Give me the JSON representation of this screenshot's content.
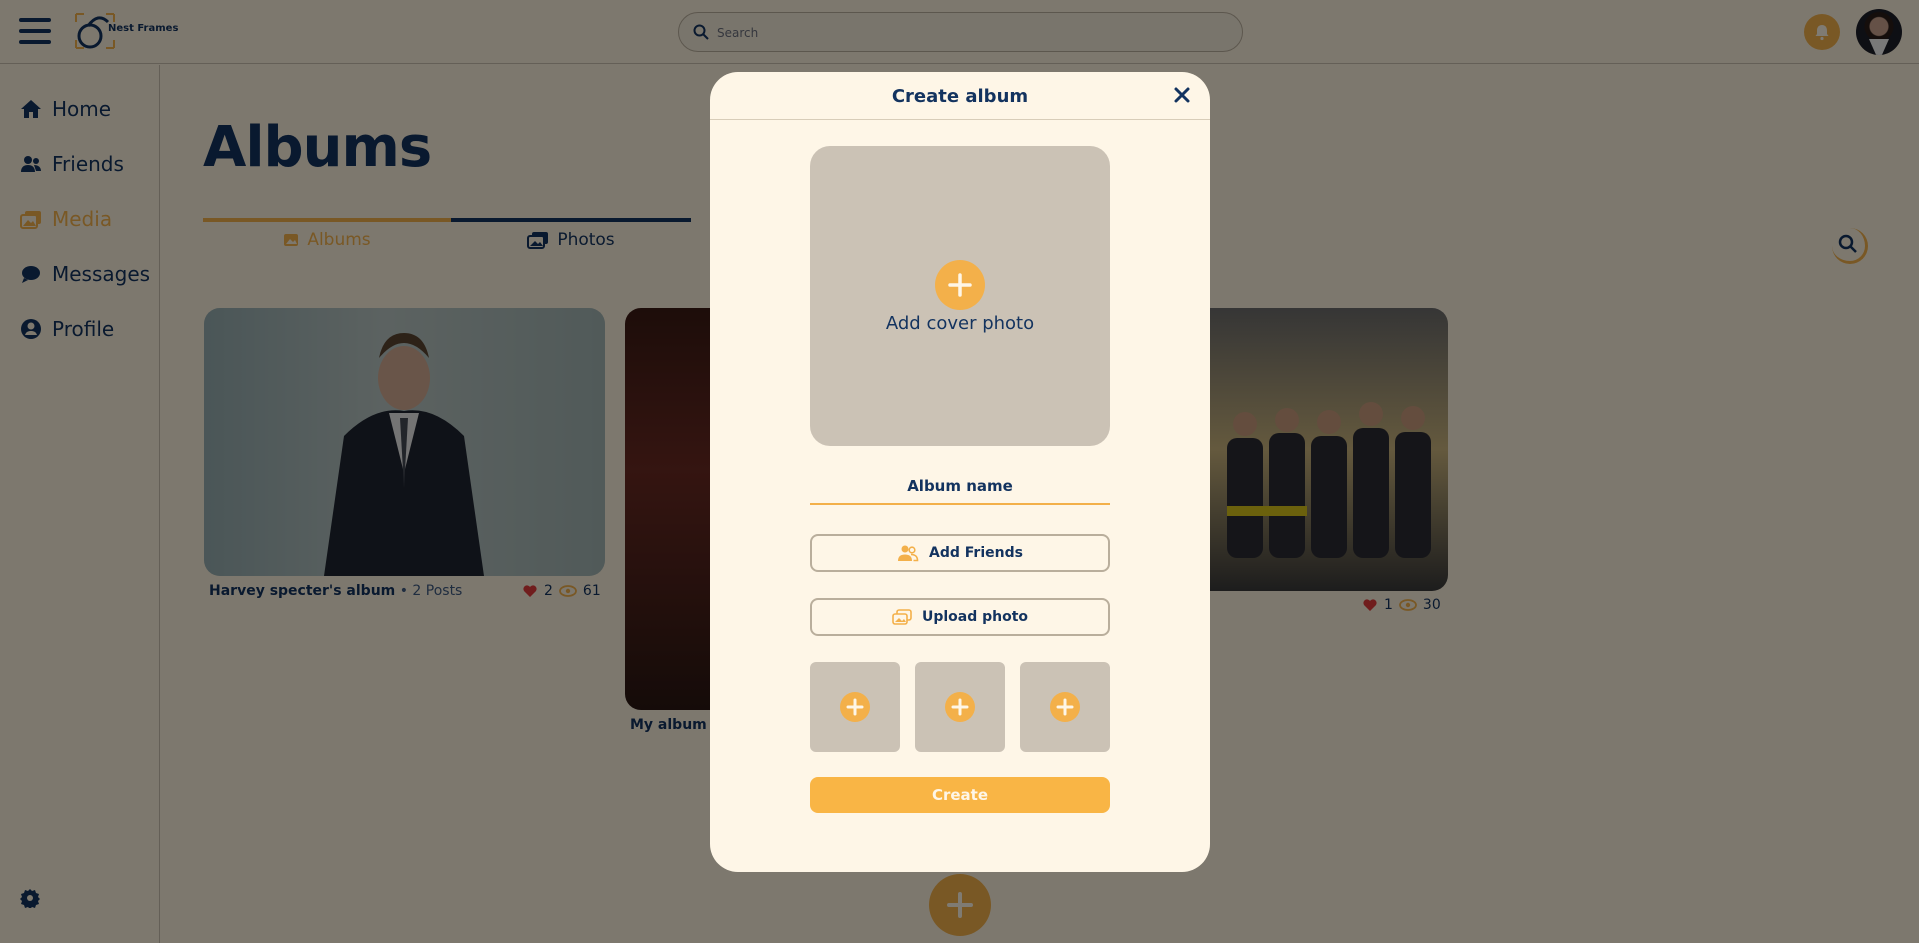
{
  "app": {
    "name": "Nest Frames",
    "search_placeholder": "Search"
  },
  "sidebar": {
    "items": [
      {
        "label": "Home",
        "icon": "home-icon"
      },
      {
        "label": "Friends",
        "icon": "friends-icon"
      },
      {
        "label": "Media",
        "icon": "media-icon",
        "active": true
      },
      {
        "label": "Messages",
        "icon": "chat-icon"
      },
      {
        "label": "Profile",
        "icon": "profile-icon"
      }
    ],
    "settings_icon": "gear-icon"
  },
  "page": {
    "title": "Albums",
    "tabs": [
      {
        "label": "Albums",
        "active": true
      },
      {
        "label": "Photos"
      }
    ]
  },
  "albums": [
    {
      "name": "Harvey specter's album",
      "posts": "• 2 Posts",
      "likes": "2",
      "views": "61"
    },
    {
      "name": "My album",
      "posts": "•",
      "likes": "",
      "views": ""
    },
    {
      "name": "",
      "posts": "",
      "likes": "1",
      "views": "30"
    }
  ],
  "modal": {
    "title": "Create album",
    "cover_label": "Add cover photo",
    "album_name_placeholder": "Album name",
    "add_friends_label": "Add Friends",
    "upload_photo_label": "Upload photo",
    "create_label": "Create",
    "photo_slots": 3
  },
  "colors": {
    "primary": "#13335f",
    "accent": "#f3b04a",
    "background": "#fbf0dc",
    "modal_bg": "#fef6e7",
    "placeholder_gray": "#cbc2b5"
  }
}
